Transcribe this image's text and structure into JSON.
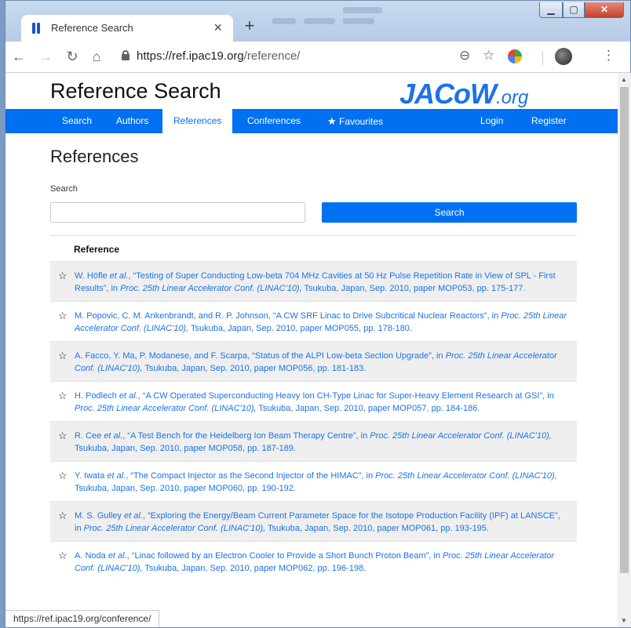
{
  "browser": {
    "tab_title": "Reference Search",
    "tab_close": "×",
    "new_tab": "+",
    "url_host": "https://ref.ipac19.org",
    "url_path": "/reference/",
    "status_url": "https://ref.ipac19.org/conference/"
  },
  "site": {
    "title": "Reference Search",
    "logo_main": "JACoW",
    "logo_suffix": ".org"
  },
  "nav": [
    {
      "label": "Search"
    },
    {
      "label": "Authors"
    },
    {
      "label": "References",
      "active": true
    },
    {
      "label": "Conferences"
    },
    {
      "label": "Favourites"
    },
    {
      "label": "Login"
    },
    {
      "label": "Register"
    }
  ],
  "page": {
    "heading": "References",
    "search_label": "Search",
    "search_value": "",
    "search_button": "Search",
    "column_header": "Reference"
  },
  "references": [
    {
      "authors": "W. Höfle",
      "etal": "et al.",
      "title": ", “Testing of Super Conducting Low-beta 704 MHz Cavities at 50 Hz Pulse Repetition Rate in View of SPL - First Results”, in ",
      "proc": "Proc. 25th Linear Accelerator Conf. (LINAC'10),",
      "rest": " Tsukuba, Japan, Sep. 2010, paper MOP053, pp. 175-177."
    },
    {
      "authors": "M. Popovic, C. M. Ankenbrandt, and R. P. Johnson",
      "etal": "",
      "title": ", “A CW SRF Linac to Drive Subcritical Nuclear Reactors”, in ",
      "proc": "Proc. 25th Linear Accelerator Conf. (LINAC'10),",
      "rest": " Tsukuba, Japan, Sep. 2010, paper MOP055, pp. 178-180."
    },
    {
      "authors": "A. Facco, Y. Ma, P. Modanese, and F. Scarpa",
      "etal": "",
      "title": ", “Status of the ALPI Low-beta Section Upgrade”, in ",
      "proc": "Proc. 25th Linear Accelerator Conf. (LINAC'10),",
      "rest": " Tsukuba, Japan, Sep. 2010, paper MOP056, pp. 181-183."
    },
    {
      "authors": "H. Podlech",
      "etal": "et al.",
      "title": ", “A CW Operated Superconducting Heavy Ion CH-Type Linac for Super-Heavy Element Research at GSI”, in ",
      "proc": "Proc. 25th Linear Accelerator Conf. (LINAC'10),",
      "rest": " Tsukuba, Japan, Sep. 2010, paper MOP057, pp. 184-186."
    },
    {
      "authors": "R. Cee",
      "etal": "et al.",
      "title": ", “A Test Bench for the Heidelberg Ion Beam Therapy Centre”, in ",
      "proc": "Proc. 25th Linear Accelerator Conf. (LINAC'10),",
      "rest": " Tsukuba, Japan, Sep. 2010, paper MOP058, pp. 187-189."
    },
    {
      "authors": "Y. Iwata",
      "etal": "et al.",
      "title": ", “The Compact Injector as the Second Injector of the HIMAC”, in ",
      "proc": "Proc. 25th Linear Accelerator Conf. (LINAC'10),",
      "rest": " Tsukuba, Japan, Sep. 2010, paper MOP060, pp. 190-192."
    },
    {
      "authors": "M. S. Gulley",
      "etal": "et al.",
      "title": ", “Exploring the Energy/Beam Current Parameter Space for the Isotope Production Facility (IPF) at LANSCE”, in ",
      "proc": "Proc. 25th Linear Accelerator Conf. (LINAC'10),",
      "rest": " Tsukuba, Japan, Sep. 2010, paper MOP061, pp. 193-195."
    },
    {
      "authors": "A. Noda",
      "etal": "et al.",
      "title": ", “Linac followed by an Electron Cooler to Provide a Short Bunch Proton Beam”, in ",
      "proc": "Proc. 25th Linear Accelerator Conf. (LINAC'10),",
      "rest": " Tsukuba, Japan, Sep. 2010, paper MOP062, pp. 196-198."
    }
  ],
  "colors": {
    "brand": "#0070f3",
    "link": "#1a73e8",
    "row_alt": "#efefef"
  }
}
